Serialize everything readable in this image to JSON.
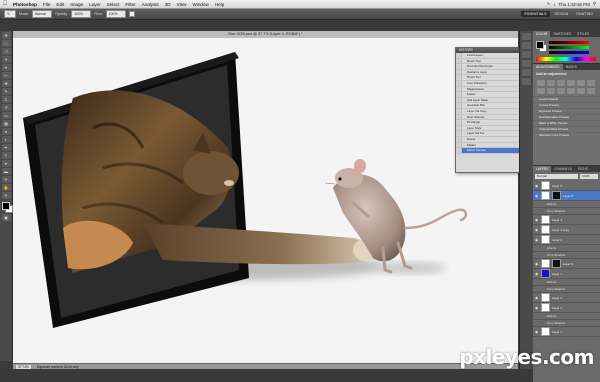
{
  "menubar": {
    "apple": "",
    "items": [
      "Photoshop",
      "File",
      "Edit",
      "Image",
      "Layer",
      "Select",
      "Filter",
      "Analysis",
      "3D",
      "View",
      "Window",
      "Help"
    ],
    "clock": "Thu 1:32:56 PM",
    "right_extra": "CS Live"
  },
  "options": {
    "mode_label": "Mode:",
    "mode_value": "Normal",
    "opacity_label": "Opacity:",
    "opacity_value": "100%",
    "flow_label": "Flow:",
    "flow_value": "100%",
    "workspaces": [
      "ESSENTIALS",
      "DESIGN",
      "PAINTING"
    ],
    "active_workspace": "ESSENTIALS"
  },
  "document": {
    "tab_title": "Dee OOB.psd @ 37.7% (Layer 0, RGB/8*) *",
    "zoom": "37.74%",
    "status": "Exposure works in 32-bit only"
  },
  "history": {
    "title": "HISTORY",
    "items": [
      "Load Layers",
      "Brush Tool",
      "Rounded Rectangle",
      "Rasterize Layer",
      "Brush Tool",
      "Free Transform",
      "Magic Eraser",
      "Eraser",
      "Add Layer Mask",
      "Gaussian Blur",
      "Layer Via Copy",
      "Drop Shadow",
      "Rectangle",
      "Layer Style",
      "Layer Via Cut",
      "Eraser",
      "Flatten",
      "Select Canvas"
    ],
    "active_index": 17,
    "dim_from": 18
  },
  "right_panels": {
    "color_tabs": [
      "COLOR",
      "SWATCHES",
      "STYLES"
    ],
    "adjust_tabs": [
      "ADJUSTMENTS",
      "MASKS"
    ],
    "adjust_title": "Add an adjustment",
    "presets": [
      "Levels Presets",
      "Curves Presets",
      "Exposure Presets",
      "Hue/Saturation Presets",
      "Black & White Presets",
      "Channel Mixer Presets",
      "Selective Color Presets"
    ],
    "layers_tabs": [
      "LAYERS",
      "CHANNELS",
      "PATHS"
    ],
    "blend_mode": "Normal",
    "opacity": "100%",
    "layers": [
      {
        "name": "Layer 9",
        "kind": "plain"
      },
      {
        "name": "Layer 8",
        "kind": "mask",
        "selected": true
      },
      {
        "name": "Effects",
        "kind": "sub"
      },
      {
        "name": "Drop Shadow",
        "kind": "sub"
      },
      {
        "name": "Layer 3",
        "kind": "plain"
      },
      {
        "name": "Layer 4 copy",
        "kind": "plain"
      },
      {
        "name": "Layer 4",
        "kind": "plain"
      },
      {
        "name": "Effects",
        "kind": "sub"
      },
      {
        "name": "Drop Shadow",
        "kind": "sub"
      },
      {
        "name": "Layer 6",
        "kind": "mask"
      },
      {
        "name": "Layer 7",
        "kind": "color"
      },
      {
        "name": "Effects",
        "kind": "sub"
      },
      {
        "name": "Drop Shadow",
        "kind": "sub"
      },
      {
        "name": "Layer 5",
        "kind": "plain"
      },
      {
        "name": "Layer 2",
        "kind": "plain"
      },
      {
        "name": "Effects",
        "kind": "sub"
      },
      {
        "name": "Drop Shadow",
        "kind": "sub"
      },
      {
        "name": "Layer 1",
        "kind": "plain"
      }
    ]
  },
  "watermark": {
    "text": "pxleyes.com"
  }
}
